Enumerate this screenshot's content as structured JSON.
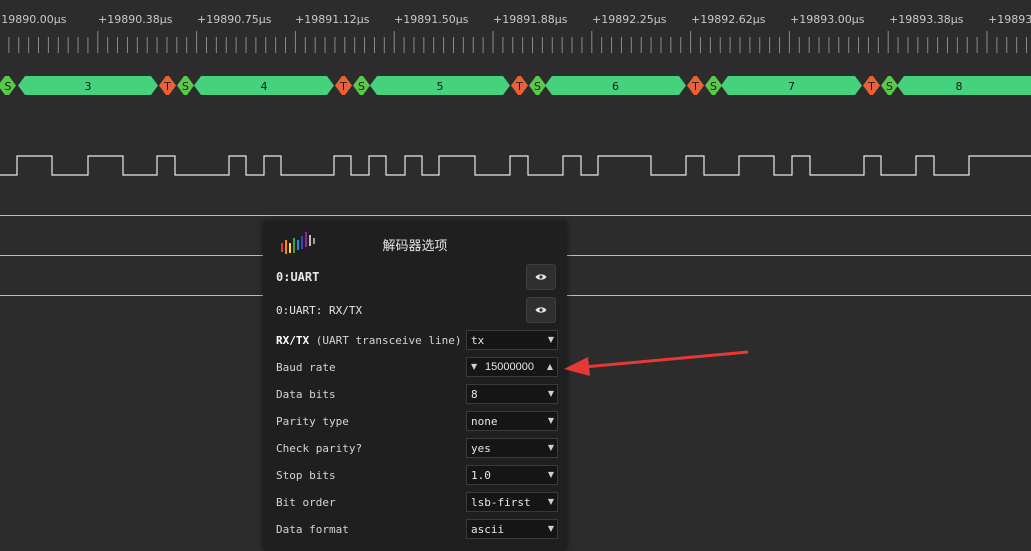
{
  "timeline": {
    "labels": [
      "+19890.00µs",
      "+19890.38µs",
      "+19890.75µs",
      "+19891.12µs",
      "+19891.50µs",
      "+19891.88µs",
      "+19892.25µs",
      "+19892.62µs",
      "+19893.00µs",
      "+19893.38µs",
      "+19893."
    ]
  },
  "decode": {
    "start_marker": "S",
    "stop_marker": "T",
    "bytes": [
      "3",
      "4",
      "5",
      "6",
      "7",
      "8"
    ],
    "colors": {
      "data": "#46d17c",
      "start": "#59c94b",
      "stop": "#e9603a"
    }
  },
  "dialog": {
    "title": "解码器选项",
    "decoder_name": "0:UART",
    "channel_name": "0:UART: RX/TX",
    "options": [
      {
        "name": "rx-tx",
        "label_bold": "RX/TX",
        "label_rest": " (UART transceive line) *",
        "value": "tx",
        "type": "select"
      },
      {
        "name": "baud-rate",
        "label_bold": "",
        "label_rest": "Baud rate",
        "value": "15000000",
        "type": "spin"
      },
      {
        "name": "data-bits",
        "label_bold": "",
        "label_rest": "Data bits",
        "value": "8",
        "type": "select"
      },
      {
        "name": "parity-type",
        "label_bold": "",
        "label_rest": "Parity type",
        "value": "none",
        "type": "select"
      },
      {
        "name": "check-parity",
        "label_bold": "",
        "label_rest": "Check parity?",
        "value": "yes",
        "type": "select"
      },
      {
        "name": "stop-bits",
        "label_bold": "",
        "label_rest": "Stop bits",
        "value": "1.0",
        "type": "select"
      },
      {
        "name": "bit-order",
        "label_bold": "",
        "label_rest": "Bit order",
        "value": "lsb-first",
        "type": "select"
      },
      {
        "name": "data-format",
        "label_bold": "",
        "label_rest": "Data format",
        "value": "ascii",
        "type": "select"
      }
    ]
  },
  "annotation": {
    "arrow_color": "#e53935"
  },
  "icons": {
    "logo": "waveform-logo-icon",
    "visibility": "eye-icon",
    "dropdown": "caret-down-icon",
    "spin_up": "caret-up-icon",
    "spin_down": "caret-down-icon"
  }
}
